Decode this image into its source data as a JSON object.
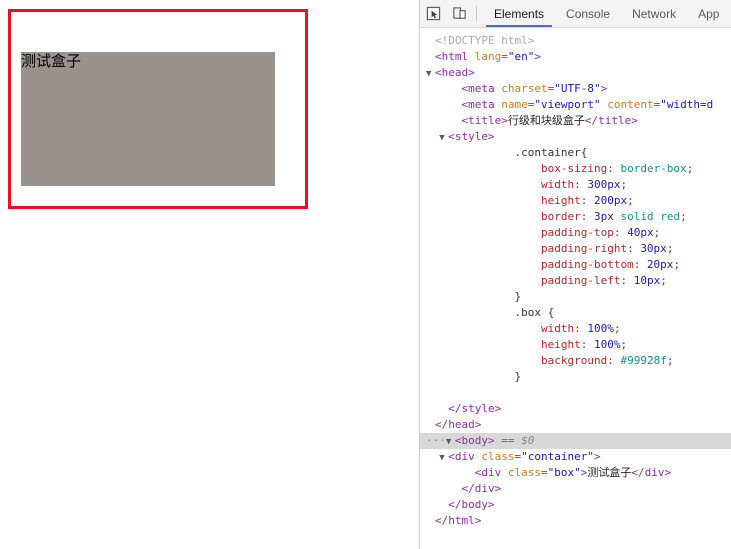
{
  "page": {
    "box_text": "测试盒子",
    "container_border_color": "#e81123",
    "box_background": "#99928f"
  },
  "devtools": {
    "toolbar": {
      "inspect_icon": "inspect-element-icon",
      "device_icon": "device-toolbar-icon",
      "tabs": [
        {
          "label": "Elements",
          "active": true
        },
        {
          "label": "Console",
          "active": false
        },
        {
          "label": "Network",
          "active": false
        },
        {
          "label": "App",
          "active": false
        }
      ]
    },
    "code_lines": [
      {
        "id": "l01",
        "indent": 0,
        "twisty": "",
        "html": "<span class=\"c-doctype\">&lt;!DOCTYPE html&gt;</span>"
      },
      {
        "id": "l02",
        "indent": 0,
        "twisty": "",
        "html": "<span class=\"c-punct\">&lt;</span><span class=\"c-tag\">html</span> <span class=\"c-attr\">lang</span><span class=\"c-punct\">=</span><span class=\"c-val\">\"en\"</span><span class=\"c-punct\">&gt;</span>"
      },
      {
        "id": "l03",
        "indent": 0,
        "twisty": "▼",
        "html": "<span class=\"c-punct\">&lt;</span><span class=\"c-tag\">head</span><span class=\"c-punct\">&gt;</span>"
      },
      {
        "id": "l04",
        "indent": 2,
        "twisty": "",
        "html": "<span class=\"c-punct\">&lt;</span><span class=\"c-tag\">meta</span> <span class=\"c-attr\">charset</span><span class=\"c-punct\">=</span><span class=\"c-val\">\"UTF-8\"</span><span class=\"c-punct\">&gt;</span>"
      },
      {
        "id": "l05",
        "indent": 2,
        "twisty": "",
        "html": "<span class=\"c-punct\">&lt;</span><span class=\"c-tag\">meta</span> <span class=\"c-attr\">name</span><span class=\"c-punct\">=</span><span class=\"c-val\">\"viewport\"</span> <span class=\"c-attr\">content</span><span class=\"c-punct\">=</span><span class=\"c-val\">\"width=d</span>"
      },
      {
        "id": "l06",
        "indent": 2,
        "twisty": "",
        "html": "<span class=\"c-punct\">&lt;</span><span class=\"c-tag\">title</span><span class=\"c-punct\">&gt;</span><span class=\"c-text\">行级和块级盒子</span><span class=\"c-punct\">&lt;/</span><span class=\"c-tag\">title</span><span class=\"c-punct\">&gt;</span>"
      },
      {
        "id": "l07",
        "indent": 1,
        "twisty": "▼",
        "html": "<span class=\"c-punct\">&lt;</span><span class=\"c-tag\">style</span><span class=\"c-punct\">&gt;</span>"
      },
      {
        "id": "l08",
        "indent": 0,
        "twisty": "",
        "html": "            <span class=\"c-sel\">.container{</span>"
      },
      {
        "id": "l09",
        "indent": 0,
        "twisty": "",
        "html": "                <span class=\"c-prop\">box-sizing</span><span class=\"c-semi\">:</span> <span class=\"c-kw\">border-box</span><span class=\"c-semi\">;</span>"
      },
      {
        "id": "l10",
        "indent": 0,
        "twisty": "",
        "html": "                <span class=\"c-prop\">width</span><span class=\"c-semi\">:</span> <span class=\"c-num\">300px</span><span class=\"c-semi\">;</span>"
      },
      {
        "id": "l11",
        "indent": 0,
        "twisty": "",
        "html": "                <span class=\"c-prop\">height</span><span class=\"c-semi\">:</span> <span class=\"c-num\">200px</span><span class=\"c-semi\">;</span>"
      },
      {
        "id": "l12",
        "indent": 0,
        "twisty": "",
        "html": "                <span class=\"c-prop\">border</span><span class=\"c-semi\">:</span> <span class=\"c-num\">3px</span> <span class=\"c-kw\">solid</span> <span class=\"c-kw\">red</span><span class=\"c-semi\">;</span>"
      },
      {
        "id": "l13",
        "indent": 0,
        "twisty": "",
        "html": "                <span class=\"c-prop\">padding-top</span><span class=\"c-semi\">:</span> <span class=\"c-num\">40px</span><span class=\"c-semi\">;</span>"
      },
      {
        "id": "l14",
        "indent": 0,
        "twisty": "",
        "html": "                <span class=\"c-prop\">padding-right</span><span class=\"c-semi\">:</span> <span class=\"c-num\">30px</span><span class=\"c-semi\">;</span>"
      },
      {
        "id": "l15",
        "indent": 0,
        "twisty": "",
        "html": "                <span class=\"c-prop\">padding-bottom</span><span class=\"c-semi\">:</span> <span class=\"c-num\">20px</span><span class=\"c-semi\">;</span>"
      },
      {
        "id": "l16",
        "indent": 0,
        "twisty": "",
        "html": "                <span class=\"c-prop\">padding-left</span><span class=\"c-semi\">:</span> <span class=\"c-num\">10px</span><span class=\"c-semi\">;</span>"
      },
      {
        "id": "l17",
        "indent": 0,
        "twisty": "",
        "html": "            <span class=\"c-brace\">}</span>"
      },
      {
        "id": "l18",
        "indent": 0,
        "twisty": "",
        "html": "            <span class=\"c-sel\">.box {</span>"
      },
      {
        "id": "l19",
        "indent": 0,
        "twisty": "",
        "html": "                <span class=\"c-prop\">width</span><span class=\"c-semi\">:</span> <span class=\"c-num\">100%</span><span class=\"c-semi\">;</span>"
      },
      {
        "id": "l20",
        "indent": 0,
        "twisty": "",
        "html": "                <span class=\"c-prop\">height</span><span class=\"c-semi\">:</span> <span class=\"c-num\">100%</span><span class=\"c-semi\">;</span>"
      },
      {
        "id": "l21",
        "indent": 0,
        "twisty": "",
        "html": "                <span class=\"c-prop\">background</span><span class=\"c-semi\">:</span> <span class=\"c-kw\">#99928f</span><span class=\"c-semi\">;</span>"
      },
      {
        "id": "l22",
        "indent": 0,
        "twisty": "",
        "html": "            <span class=\"c-brace\">}</span>"
      },
      {
        "id": "l23",
        "indent": 0,
        "twisty": "",
        "html": ""
      },
      {
        "id": "l24",
        "indent": 1,
        "twisty": "",
        "html": "<span class=\"c-punct\">&lt;/</span><span class=\"c-tag\">style</span><span class=\"c-punct\">&gt;</span>"
      },
      {
        "id": "l25",
        "indent": 0,
        "twisty": "",
        "html": "<span class=\"c-punct\">&lt;/</span><span class=\"c-tag\">head</span><span class=\"c-punct\">&gt;</span>"
      },
      {
        "id": "l26",
        "indent": 0,
        "twisty": "▼",
        "selected": true,
        "dots": true,
        "html": "<span class=\"c-punct\">&lt;</span><span class=\"c-tag\">body</span><span class=\"c-punct\">&gt;</span> <span class=\"c-eq\">==</span> <span class=\"c-dollar\">$0</span>"
      },
      {
        "id": "l27",
        "indent": 1,
        "twisty": "▼",
        "html": "<span class=\"c-punct\">&lt;</span><span class=\"c-tag\">div</span> <span class=\"c-attr\">class</span><span class=\"c-punct\">=</span><span class=\"c-val\">\"container\"</span><span class=\"c-punct\">&gt;</span>"
      },
      {
        "id": "l28",
        "indent": 3,
        "twisty": "",
        "html": "<span class=\"c-punct\">&lt;</span><span class=\"c-tag\">div</span> <span class=\"c-attr\">class</span><span class=\"c-punct\">=</span><span class=\"c-val\">\"box\"</span><span class=\"c-punct\">&gt;</span><span class=\"c-text\">测试盒子</span><span class=\"c-punct\">&lt;/</span><span class=\"c-tag\">div</span><span class=\"c-punct\">&gt;</span>"
      },
      {
        "id": "l29",
        "indent": 2,
        "twisty": "",
        "html": "<span class=\"c-punct\">&lt;/</span><span class=\"c-tag\">div</span><span class=\"c-punct\">&gt;</span>"
      },
      {
        "id": "l30",
        "indent": 1,
        "twisty": "",
        "html": "<span class=\"c-punct\">&lt;/</span><span class=\"c-tag\">body</span><span class=\"c-punct\">&gt;</span>"
      },
      {
        "id": "l31",
        "indent": 0,
        "twisty": "",
        "html": "<span class=\"c-punct\">&lt;/</span><span class=\"c-tag\">html</span><span class=\"c-punct\">&gt;</span>"
      }
    ]
  }
}
